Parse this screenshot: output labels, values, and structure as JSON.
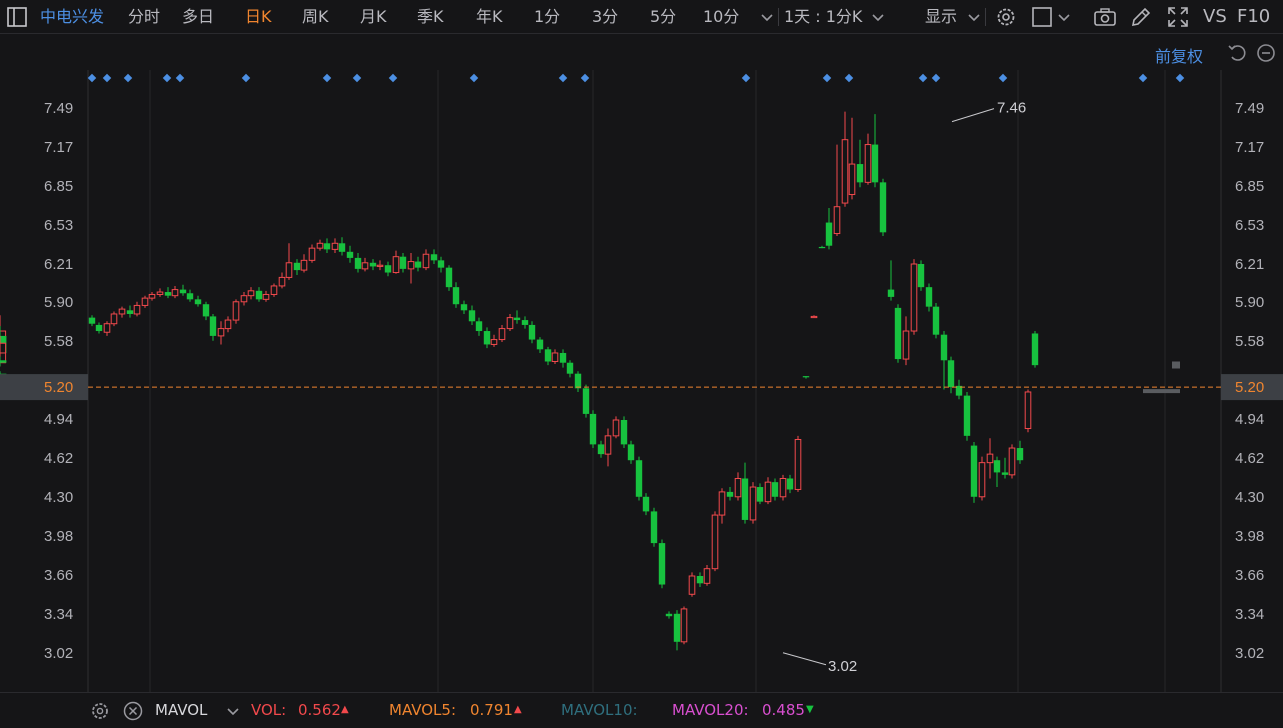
{
  "toolbar": {
    "stock_name": "中电兴发",
    "periods": [
      "分时",
      "多日",
      "日K",
      "周K",
      "月K",
      "季K",
      "年K",
      "1分",
      "3分",
      "5分",
      "10分"
    ],
    "active_period": "日K",
    "interval": "1天 : 1分K",
    "display": "显示",
    "vs": "VS",
    "f10": "F10"
  },
  "adjust": {
    "label": "前复权"
  },
  "price_axis": {
    "ticks": [
      "7.49",
      "7.17",
      "6.85",
      "6.53",
      "6.21",
      "5.90",
      "5.58",
      "5.20",
      "4.94",
      "4.62",
      "4.30",
      "3.98",
      "3.66",
      "3.34",
      "3.02"
    ],
    "current": "5.20"
  },
  "annotations": {
    "high": "7.46",
    "low": "3.02"
  },
  "colors": {
    "up": "#f2494c",
    "down": "#17c23f",
    "accent": "#f0852f",
    "link": "#4c8fe3",
    "marker": "#4c8fe3"
  },
  "indicator": {
    "name": "MAVOL",
    "vol_label": "VOL:",
    "vol_value": "0.562",
    "mavol5_label": "MAVOL5:",
    "mavol5_value": "0.791",
    "mavol10_label": "MAVOL10:",
    "mavol20_label": "MAVOL20:",
    "mavol20_value": "0.485"
  },
  "chart_data": {
    "type": "candlestick",
    "ylim": [
      2.95,
      7.6
    ],
    "y_ticks": [
      7.49,
      7.17,
      6.85,
      6.53,
      6.21,
      5.9,
      5.58,
      5.2,
      4.94,
      4.62,
      4.3,
      3.98,
      3.66,
      3.34,
      3.02
    ],
    "reference_price": 5.2,
    "candles": [
      [
        5.77,
        5.72,
        5.79,
        5.7
      ],
      [
        5.71,
        5.66,
        5.73,
        5.64
      ],
      [
        5.65,
        5.72,
        5.74,
        5.62
      ],
      [
        5.72,
        5.8,
        5.82,
        5.7
      ],
      [
        5.8,
        5.84,
        5.86,
        5.77
      ],
      [
        5.83,
        5.8,
        5.87,
        5.77
      ],
      [
        5.8,
        5.87,
        5.9,
        5.78
      ],
      [
        5.87,
        5.93,
        5.95,
        5.85
      ],
      [
        5.93,
        5.96,
        5.98,
        5.91
      ],
      [
        5.96,
        5.98,
        6.01,
        5.94
      ],
      [
        5.98,
        5.95,
        6.02,
        5.93
      ],
      [
        5.95,
        6.0,
        6.03,
        5.93
      ],
      [
        6.0,
        5.97,
        6.04,
        5.95
      ],
      [
        5.97,
        5.92,
        6.0,
        5.9
      ],
      [
        5.92,
        5.88,
        5.95,
        5.86
      ],
      [
        5.88,
        5.78,
        5.9,
        5.75
      ],
      [
        5.78,
        5.62,
        5.8,
        5.58
      ],
      [
        5.62,
        5.68,
        5.74,
        5.55
      ],
      [
        5.68,
        5.75,
        5.78,
        5.65
      ],
      [
        5.75,
        5.9,
        5.92,
        5.72
      ],
      [
        5.9,
        5.95,
        5.98,
        5.87
      ],
      [
        5.95,
        5.99,
        6.02,
        5.92
      ],
      [
        5.99,
        5.92,
        6.02,
        5.9
      ],
      [
        5.92,
        5.96,
        5.99,
        5.9
      ],
      [
        5.96,
        6.03,
        6.05,
        5.94
      ],
      [
        6.03,
        6.1,
        6.14,
        6.01
      ],
      [
        6.1,
        6.22,
        6.38,
        6.08
      ],
      [
        6.22,
        6.16,
        6.25,
        6.12
      ],
      [
        6.16,
        6.24,
        6.29,
        6.14
      ],
      [
        6.24,
        6.34,
        6.37,
        6.22
      ],
      [
        6.34,
        6.38,
        6.41,
        6.32
      ],
      [
        6.38,
        6.33,
        6.42,
        6.3
      ],
      [
        6.33,
        6.38,
        6.42,
        6.3
      ],
      [
        6.38,
        6.31,
        6.43,
        6.28
      ],
      [
        6.31,
        6.26,
        6.36,
        6.22
      ],
      [
        6.26,
        6.17,
        6.3,
        6.14
      ],
      [
        6.17,
        6.22,
        6.26,
        6.15
      ],
      [
        6.22,
        6.19,
        6.25,
        6.16
      ],
      [
        6.19,
        6.2,
        6.24,
        6.16
      ],
      [
        6.2,
        6.14,
        6.23,
        6.11
      ],
      [
        6.14,
        6.27,
        6.32,
        6.13
      ],
      [
        6.27,
        6.17,
        6.3,
        6.14
      ],
      [
        6.17,
        6.23,
        6.3,
        6.05
      ],
      [
        6.23,
        6.18,
        6.27,
        6.15
      ],
      [
        6.18,
        6.29,
        6.33,
        6.16
      ],
      [
        6.29,
        6.24,
        6.33,
        6.21
      ],
      [
        6.24,
        6.18,
        6.27,
        6.14
      ],
      [
        6.18,
        6.02,
        6.2,
        5.99
      ],
      [
        6.02,
        5.88,
        6.06,
        5.85
      ],
      [
        5.88,
        5.83,
        5.91,
        5.8
      ],
      [
        5.83,
        5.74,
        5.87,
        5.71
      ],
      [
        5.74,
        5.66,
        5.77,
        5.62
      ],
      [
        5.66,
        5.55,
        5.69,
        5.52
      ],
      [
        5.55,
        5.59,
        5.63,
        5.53
      ],
      [
        5.59,
        5.68,
        5.71,
        5.57
      ],
      [
        5.68,
        5.77,
        5.8,
        5.66
      ],
      [
        5.77,
        5.75,
        5.83,
        5.72
      ],
      [
        5.75,
        5.71,
        5.78,
        5.68
      ],
      [
        5.71,
        5.59,
        5.74,
        5.56
      ],
      [
        5.59,
        5.51,
        5.61,
        5.48
      ],
      [
        5.51,
        5.41,
        5.53,
        5.38
      ],
      [
        5.41,
        5.48,
        5.51,
        5.39
      ],
      [
        5.48,
        5.4,
        5.51,
        5.36
      ],
      [
        5.4,
        5.31,
        5.42,
        5.28
      ],
      [
        5.31,
        5.19,
        5.33,
        5.16
      ],
      [
        5.19,
        4.98,
        5.22,
        4.95
      ],
      [
        4.98,
        4.73,
        5.01,
        4.7
      ],
      [
        4.73,
        4.65,
        4.76,
        4.62
      ],
      [
        4.65,
        4.8,
        4.86,
        4.55
      ],
      [
        4.8,
        4.93,
        4.96,
        4.78
      ],
      [
        4.93,
        4.73,
        4.96,
        4.7
      ],
      [
        4.73,
        4.6,
        4.76,
        4.57
      ],
      [
        4.6,
        4.3,
        4.63,
        4.27
      ],
      [
        4.3,
        4.18,
        4.33,
        4.15
      ],
      [
        4.18,
        3.92,
        4.21,
        3.89
      ],
      [
        3.92,
        3.58,
        3.95,
        3.55
      ],
      [
        3.34,
        3.32,
        3.36,
        3.3
      ],
      [
        3.34,
        3.11,
        3.37,
        3.04
      ],
      [
        3.11,
        3.38,
        3.4,
        3.09
      ],
      [
        3.5,
        3.65,
        3.68,
        3.48
      ],
      [
        3.65,
        3.59,
        3.68,
        3.56
      ],
      [
        3.59,
        3.71,
        3.74,
        3.57
      ],
      [
        3.71,
        4.15,
        4.18,
        3.69
      ],
      [
        4.15,
        4.34,
        4.37,
        4.08
      ],
      [
        4.34,
        4.3,
        4.38,
        4.27
      ],
      [
        4.3,
        4.45,
        4.5,
        4.27
      ],
      [
        4.45,
        4.11,
        4.58,
        4.08
      ],
      [
        4.11,
        4.38,
        4.42,
        4.08
      ],
      [
        4.38,
        4.26,
        4.41,
        4.24
      ],
      [
        4.26,
        4.42,
        4.46,
        4.24
      ],
      [
        4.42,
        4.3,
        4.45,
        4.27
      ],
      [
        4.3,
        4.45,
        4.48,
        4.27
      ],
      [
        4.45,
        4.36,
        4.48,
        4.33
      ],
      [
        4.36,
        4.77,
        4.8,
        4.34
      ],
      [
        5.29,
        5.28,
        5.29,
        5.27
      ],
      [
        5.78,
        5.78,
        5.79,
        5.77
      ],
      [
        6.35,
        6.34,
        6.36,
        6.34
      ],
      [
        6.55,
        6.36,
        6.67,
        6.33
      ],
      [
        6.46,
        6.68,
        7.19,
        6.44
      ],
      [
        6.71,
        7.23,
        7.46,
        6.68
      ],
      [
        6.78,
        7.03,
        7.41,
        6.74
      ],
      [
        7.03,
        6.88,
        7.23,
        6.84
      ],
      [
        6.88,
        7.19,
        7.28,
        6.86
      ],
      [
        7.19,
        6.88,
        7.44,
        6.84
      ],
      [
        6.88,
        6.47,
        6.91,
        6.44
      ],
      [
        6.0,
        5.94,
        6.24,
        5.91
      ],
      [
        5.85,
        5.43,
        5.88,
        5.4
      ],
      [
        5.43,
        5.66,
        5.78,
        5.38
      ],
      [
        5.66,
        6.21,
        6.25,
        5.63
      ],
      [
        6.21,
        6.02,
        6.24,
        5.99
      ],
      [
        6.02,
        5.86,
        6.05,
        5.82
      ],
      [
        5.86,
        5.63,
        5.89,
        5.6
      ],
      [
        5.63,
        5.42,
        5.66,
        5.18
      ],
      [
        5.42,
        5.2,
        5.45,
        5.15
      ],
      [
        5.21,
        5.13,
        5.26,
        5.1
      ],
      [
        5.13,
        4.8,
        5.16,
        4.76
      ],
      [
        4.72,
        4.3,
        4.75,
        4.25
      ],
      [
        4.3,
        4.58,
        4.63,
        4.27
      ],
      [
        4.58,
        4.65,
        4.78,
        4.45
      ],
      [
        4.6,
        4.5,
        4.63,
        4.38
      ],
      [
        4.5,
        4.48,
        4.62,
        4.45
      ],
      [
        4.48,
        4.7,
        4.73,
        4.45
      ],
      [
        4.7,
        4.6,
        4.76,
        4.57
      ],
      [
        4.86,
        5.16,
        5.18,
        4.83
      ],
      [
        5.64,
        5.38,
        5.66,
        5.36
      ],
      [
        5.4,
        5.66,
        5.79,
        5.37
      ],
      [
        5.62,
        5.48,
        5.7,
        5.45
      ],
      [
        5.48,
        5.56,
        5.62,
        5.45
      ],
      [
        5.42,
        5.4,
        5.45,
        5.37
      ],
      [
        5.31,
        5.21,
        5.33,
        5.19
      ]
    ],
    "x_positions": [
      92,
      99,
      107,
      114,
      122,
      130,
      137,
      145,
      152,
      160,
      168,
      175,
      183,
      190,
      198,
      206,
      213,
      221,
      228,
      236,
      244,
      251,
      259,
      266,
      274,
      282,
      289,
      297,
      304,
      312,
      320,
      327,
      335,
      342,
      350,
      358,
      365,
      373,
      380,
      388,
      396,
      403,
      411,
      418,
      426,
      434,
      441,
      449,
      456,
      464,
      472,
      479,
      487,
      494,
      502,
      510,
      517,
      525,
      532,
      540,
      548,
      555,
      563,
      570,
      578,
      586,
      593,
      601,
      608,
      616,
      624,
      631,
      639,
      646,
      654,
      662,
      669,
      677,
      684,
      692,
      700,
      707,
      715,
      722,
      730,
      738,
      745,
      753,
      760,
      768,
      775,
      783,
      790,
      798,
      806,
      814,
      822,
      829,
      837,
      845,
      852,
      860,
      868,
      875,
      883,
      891,
      898,
      906,
      914,
      921,
      929,
      936,
      944,
      951,
      959,
      967,
      974,
      982,
      990,
      997,
      1005,
      1012,
      1020,
      1028,
      1035
    ],
    "markers_x": [
      92,
      107,
      128,
      167,
      180,
      246,
      327,
      357,
      393,
      474,
      563,
      585,
      746,
      827,
      849,
      923,
      936,
      1003,
      1143,
      1180
    ]
  }
}
